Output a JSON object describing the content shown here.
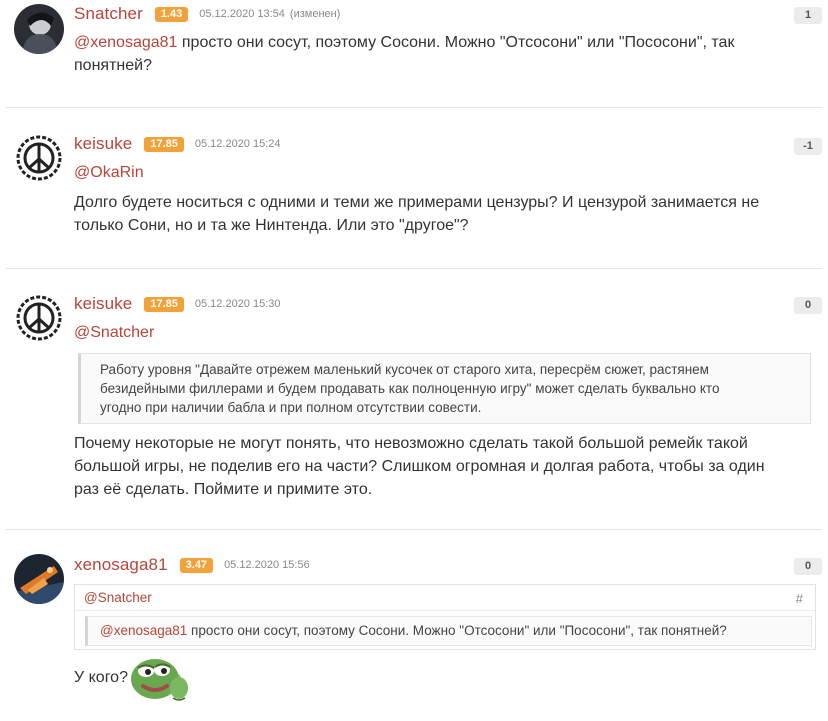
{
  "comments": [
    {
      "username": "Snatcher",
      "karma": "1.43",
      "timestamp": "05.12.2020 13:54",
      "edited": "(изменен)",
      "rating": "1",
      "mention": "@xenosaga81",
      "line1": " просто они сосут, поэтому Сосони. Можно \"Отсосони\" или \"Пососони\", так",
      "line2": "понятней?"
    },
    {
      "username": "keisuke",
      "karma": "17.85",
      "timestamp": "05.12.2020 15:24",
      "rating": "-1",
      "mention": "@OkaRin",
      "line1": "Долго будете носиться с одними и теми же примерами цензуры? И цензурой занимается не",
      "line2": "только Сони, но и та же Нинтенда. Или это \"другое\"?"
    },
    {
      "username": "keisuke",
      "karma": "17.85",
      "timestamp": "05.12.2020 15:30",
      "rating": "0",
      "mention": "@Snatcher",
      "quote_lines": [
        "Работу уровня \"Давайте отрежем маленький кусочек от старого хита, пересрём сюжет, растянем",
        "безидейными филлерами и будем продавать как полноценную игру\" может сделать буквально кто",
        "угодно при наличии бабла и при полном отсутствии совести."
      ],
      "body_lines": [
        "Почему некоторые не могут понять, что невозможно сделать такой большой ремейк такой",
        "большой игры, не поделив его на части? Слишком огромная и долгая работа, чтобы за один",
        "раз её сделать. Поймите и примите это."
      ]
    },
    {
      "username": "xenosaga81",
      "karma": "3.47",
      "timestamp": "05.12.2020 15:56",
      "rating": "0",
      "reply_to": "@Snatcher",
      "reply_hash": "#",
      "reply_mention": "@xenosaga81",
      "reply_text": " просто они сосут, поэтому Сосони. Можно \"Отсосони\" или \"Пососони\", так понятней?",
      "body": "У кого?",
      "emoji": "pepe-frog-emoji"
    }
  ],
  "colors": {
    "username": "#b5453a",
    "karma_badge": "#f2a23a",
    "rating_badge": "#ececec"
  }
}
